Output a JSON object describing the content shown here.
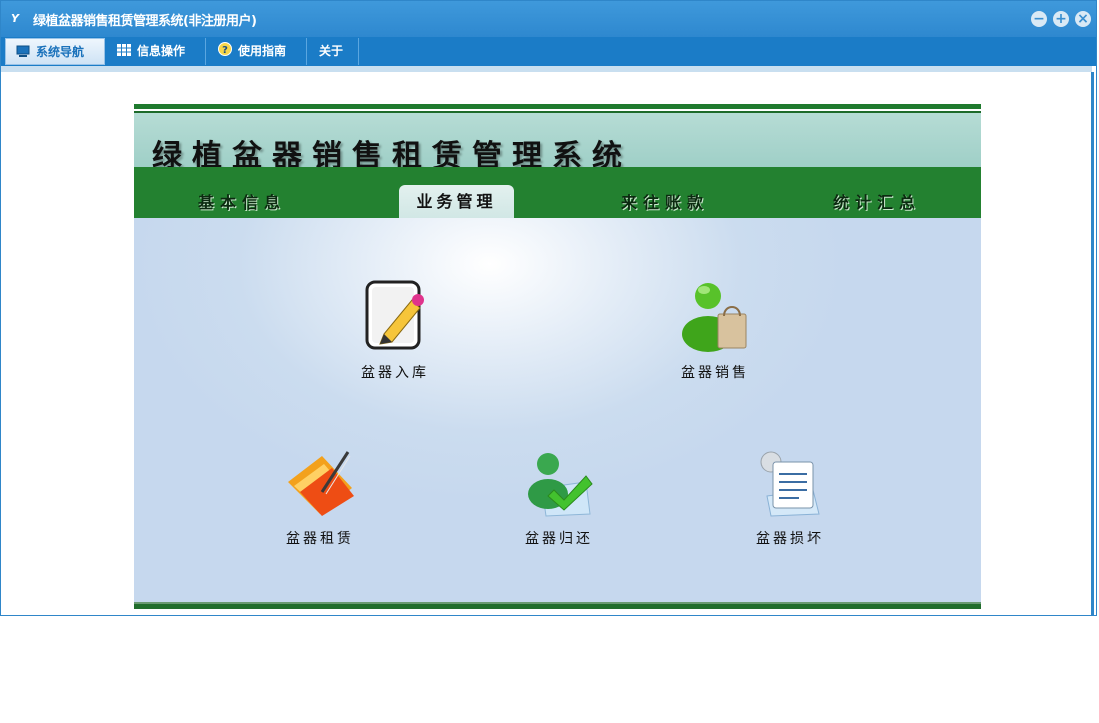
{
  "window": {
    "title": "绿植盆器销售租赁管理系统(非注册用户)",
    "app_icon": "Y",
    "accent": "#2e88cf",
    "controls": [
      "minimize-icon",
      "maximize-icon",
      "close-icon"
    ]
  },
  "menu": {
    "tabs": [
      {
        "label": "系统导航",
        "icon": "monitor-icon",
        "active": true
      },
      {
        "label": "信息操作",
        "icon": "grid-icon",
        "active": false
      },
      {
        "label": "使用指南",
        "icon": "help-icon",
        "active": false
      },
      {
        "label": "关于",
        "icon": "",
        "active": false
      }
    ]
  },
  "panel": {
    "system_title": "绿植盆器销售租赁管理系统",
    "nav_tabs": [
      {
        "label": "基本信息",
        "active": false
      },
      {
        "label": "业务管理",
        "active": true
      },
      {
        "label": "来往账款",
        "active": false
      },
      {
        "label": "统计汇总",
        "active": false
      }
    ],
    "items": [
      {
        "label": "盆器入库",
        "icon": "edit-document-icon"
      },
      {
        "label": "盆器销售",
        "icon": "user-shopping-bag-icon"
      },
      {
        "label": "盆器租赁",
        "icon": "folder-pen-icon"
      },
      {
        "label": "盆器归还",
        "icon": "user-check-icon"
      },
      {
        "label": "盆器损坏",
        "icon": "clipboard-list-icon"
      }
    ],
    "colors": {
      "nav_green": "#238130",
      "header_teal": "#9fcfc7",
      "body_blue": "#c6d8ee"
    }
  }
}
